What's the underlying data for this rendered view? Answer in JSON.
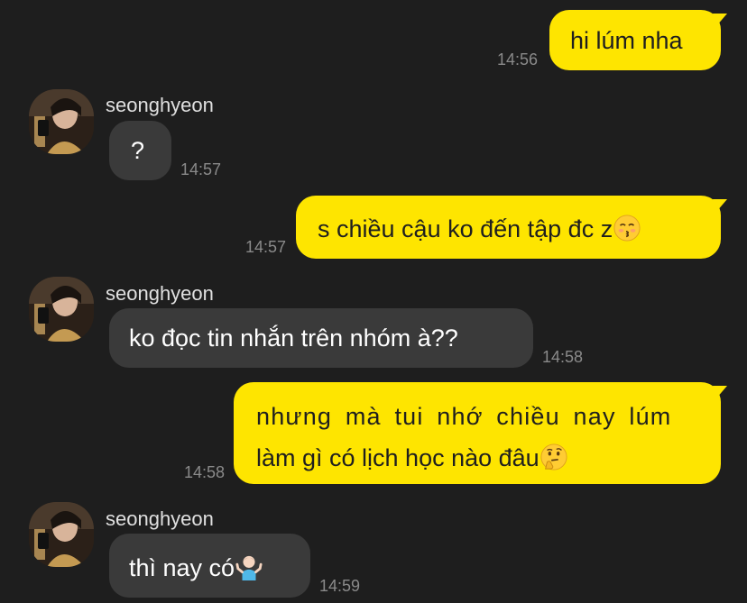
{
  "messages": [
    {
      "direction": "outgoing",
      "text": "hi lúm nha",
      "time": "14:56"
    },
    {
      "direction": "incoming",
      "sender": "seonghyeon",
      "text": "?",
      "time": "14:57"
    },
    {
      "direction": "outgoing",
      "text": "s chiều cậu ko đến tập đc z",
      "emoji": "kissing-face-closed-eyes",
      "time": "14:57"
    },
    {
      "direction": "incoming",
      "sender": "seonghyeon",
      "text": "ko đọc tin nhắn trên nhóm à??",
      "time": "14:58"
    },
    {
      "direction": "outgoing",
      "line1": "nhưng mà tui nhớ chiều nay lúm",
      "line2": "làm gì có lịch học nào đâu",
      "emoji": "thinking-face",
      "time": "14:58"
    },
    {
      "direction": "incoming",
      "sender": "seonghyeon",
      "text": "thì nay có",
      "emoji": "person-shrugging",
      "time": "14:59"
    }
  ],
  "colors": {
    "background": "#1e1e1e",
    "outgoing_bubble": "#fee500",
    "incoming_bubble": "#3a3a3a",
    "timestamp": "#8a8a8a"
  }
}
